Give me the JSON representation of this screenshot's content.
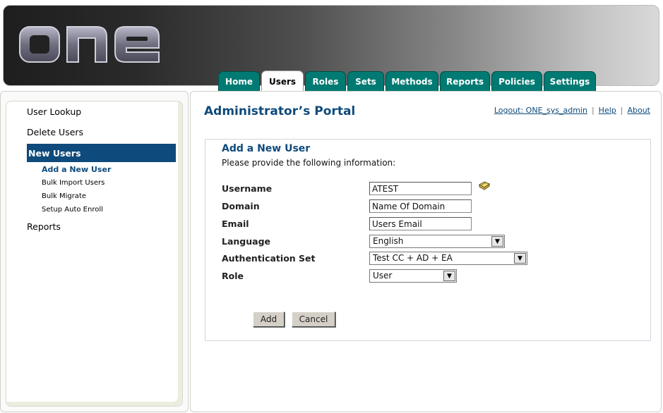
{
  "header": {
    "logo_text": "one"
  },
  "tabs": [
    {
      "label": "Home"
    },
    {
      "label": "Users"
    },
    {
      "label": "Roles"
    },
    {
      "label": "Sets"
    },
    {
      "label": "Methods"
    },
    {
      "label": "Reports"
    },
    {
      "label": "Policies"
    },
    {
      "label": "Settings"
    }
  ],
  "sidebar": {
    "items": [
      "User Lookup",
      "Delete Users",
      "New Users",
      "Reports"
    ],
    "sub_items": [
      "Add a New User",
      "Bulk Import Users",
      "Bulk Migrate",
      "Setup Auto Enroll"
    ]
  },
  "main": {
    "title": "Administrator’s Portal",
    "links": {
      "logout": "Logout: ONE_sys_admin",
      "help": "Help",
      "about": "About",
      "separator": "|"
    },
    "form": {
      "title": "Add a New User",
      "subtitle": "Please provide the following information:",
      "fields": {
        "username": {
          "label": "Username",
          "value": "ATEST"
        },
        "domain": {
          "label": "Domain",
          "value": "Name Of Domain"
        },
        "email": {
          "label": "Email",
          "value": "Users Email"
        },
        "language": {
          "label": "Language",
          "value": "English"
        },
        "auth_set": {
          "label": "Authentication Set",
          "value": "Test CC + AD + EA"
        },
        "role": {
          "label": "Role",
          "value": "User"
        }
      },
      "add_label": "Add",
      "cancel_label": "Cancel"
    }
  },
  "colors": {
    "tab": "#007a72",
    "accent": "#0e4a7b"
  }
}
